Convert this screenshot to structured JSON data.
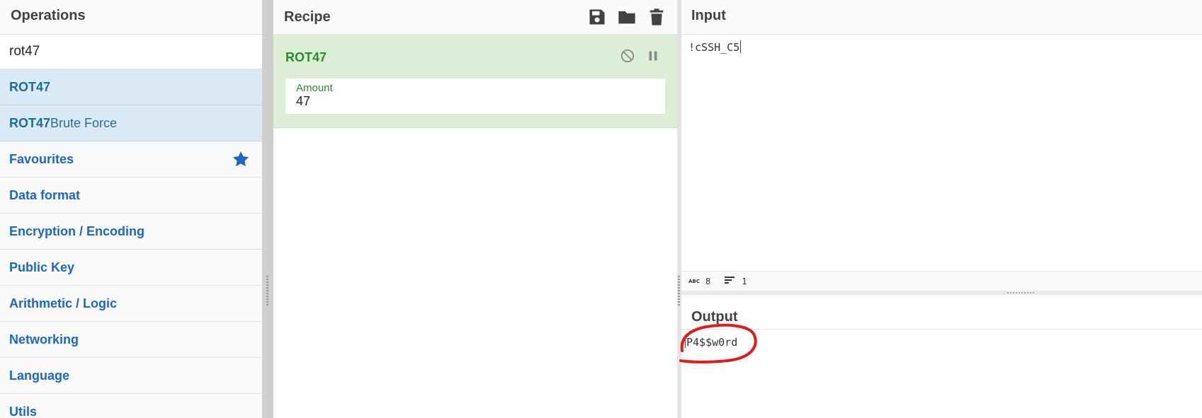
{
  "operations": {
    "title": "Operations",
    "search_value": "rot47",
    "results": [
      {
        "bold": "ROT47",
        "rest": ""
      },
      {
        "bold": "ROT47",
        "rest": " Brute Force"
      }
    ],
    "categories": [
      {
        "label": "Favourites",
        "icon": "star-icon"
      },
      {
        "label": "Data format"
      },
      {
        "label": "Encryption / Encoding"
      },
      {
        "label": "Public Key"
      },
      {
        "label": "Arithmetic / Logic"
      },
      {
        "label": "Networking"
      },
      {
        "label": "Language"
      },
      {
        "label": "Utils"
      }
    ]
  },
  "recipe": {
    "title": "Recipe",
    "tools": [
      "save-icon",
      "folder-icon",
      "trash-icon"
    ],
    "ops": [
      {
        "name": "ROT47",
        "arg_label": "Amount",
        "arg_value": "47",
        "controls": [
          "disable-icon",
          "pause-icon"
        ]
      }
    ]
  },
  "io": {
    "input_title": "Input",
    "input_text": "!cSSH_C5",
    "stats": {
      "chars": "8",
      "lines": "1"
    },
    "output_title": "Output",
    "output_text": "P4$$w0rd"
  },
  "colors": {
    "category_text": "#1c66c4",
    "result_bg": "#d9eaf6",
    "recipe_op_bg": "#dcefd6",
    "recipe_op_text": "#2d8a2d",
    "annotation_circle": "#e01b1b"
  }
}
